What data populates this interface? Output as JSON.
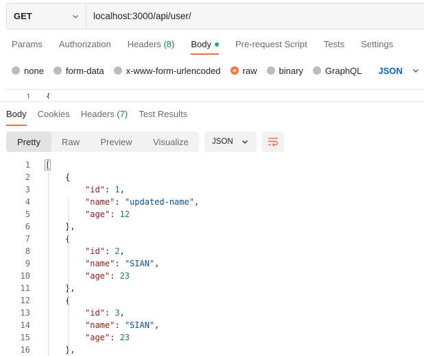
{
  "request": {
    "method": "GET",
    "url": "localhost:3000/api/user/"
  },
  "request_tabs": [
    {
      "label": "Params"
    },
    {
      "label": "Authorization"
    },
    {
      "label": "Headers",
      "count": "(8)"
    },
    {
      "label": "Body",
      "active": true,
      "dot": true
    },
    {
      "label": "Pre-request Script"
    },
    {
      "label": "Tests"
    },
    {
      "label": "Settings"
    }
  ],
  "body_types": [
    {
      "label": "none"
    },
    {
      "label": "form-data"
    },
    {
      "label": "x-www-form-urlencoded"
    },
    {
      "label": "raw",
      "checked": true
    },
    {
      "label": "binary"
    },
    {
      "label": "GraphQL"
    }
  ],
  "body_language": "JSON",
  "request_editor": {
    "line": "1",
    "text": "{"
  },
  "response_tabs": [
    {
      "label": "Body",
      "active": true
    },
    {
      "label": "Cookies"
    },
    {
      "label": "Headers",
      "count": "(7)"
    },
    {
      "label": "Test Results"
    }
  ],
  "view_modes": [
    {
      "label": "Pretty",
      "active": true
    },
    {
      "label": "Raw"
    },
    {
      "label": "Preview"
    },
    {
      "label": "Visualize"
    }
  ],
  "response_format": "JSON",
  "colors": {
    "accent": "#ff6c37",
    "link": "#0265d2",
    "count": "#0a8f3f"
  },
  "icons": {
    "wrap": "wrap-lines-icon",
    "dropdown": "chevron-down-icon"
  },
  "code_lines": [
    {
      "n": "1",
      "indent": 0,
      "parts": [
        {
          "t": "p",
          "v": "["
        }
      ]
    },
    {
      "n": "2",
      "indent": 1,
      "parts": [
        {
          "t": "p",
          "v": "{"
        }
      ]
    },
    {
      "n": "3",
      "indent": 2,
      "parts": [
        {
          "t": "k",
          "v": "\"id\""
        },
        {
          "t": "p",
          "v": ": "
        },
        {
          "t": "n",
          "v": "1"
        },
        {
          "t": "p",
          "v": ","
        }
      ]
    },
    {
      "n": "4",
      "indent": 2,
      "parts": [
        {
          "t": "k",
          "v": "\"name\""
        },
        {
          "t": "p",
          "v": ": "
        },
        {
          "t": "s",
          "v": "\"updated-name\""
        },
        {
          "t": "p",
          "v": ","
        }
      ]
    },
    {
      "n": "5",
      "indent": 2,
      "parts": [
        {
          "t": "k",
          "v": "\"age\""
        },
        {
          "t": "p",
          "v": ": "
        },
        {
          "t": "n",
          "v": "12"
        }
      ]
    },
    {
      "n": "6",
      "indent": 1,
      "parts": [
        {
          "t": "p",
          "v": "},"
        }
      ]
    },
    {
      "n": "7",
      "indent": 1,
      "parts": [
        {
          "t": "p",
          "v": "{"
        }
      ]
    },
    {
      "n": "8",
      "indent": 2,
      "parts": [
        {
          "t": "k",
          "v": "\"id\""
        },
        {
          "t": "p",
          "v": ": "
        },
        {
          "t": "n",
          "v": "2"
        },
        {
          "t": "p",
          "v": ","
        }
      ]
    },
    {
      "n": "9",
      "indent": 2,
      "parts": [
        {
          "t": "k",
          "v": "\"name\""
        },
        {
          "t": "p",
          "v": ": "
        },
        {
          "t": "s",
          "v": "\"SIAN\""
        },
        {
          "t": "p",
          "v": ","
        }
      ]
    },
    {
      "n": "10",
      "indent": 2,
      "parts": [
        {
          "t": "k",
          "v": "\"age\""
        },
        {
          "t": "p",
          "v": ": "
        },
        {
          "t": "n",
          "v": "23"
        }
      ]
    },
    {
      "n": "11",
      "indent": 1,
      "parts": [
        {
          "t": "p",
          "v": "},"
        }
      ]
    },
    {
      "n": "12",
      "indent": 1,
      "parts": [
        {
          "t": "p",
          "v": "{"
        }
      ]
    },
    {
      "n": "13",
      "indent": 2,
      "parts": [
        {
          "t": "k",
          "v": "\"id\""
        },
        {
          "t": "p",
          "v": ": "
        },
        {
          "t": "n",
          "v": "3"
        },
        {
          "t": "p",
          "v": ","
        }
      ]
    },
    {
      "n": "14",
      "indent": 2,
      "parts": [
        {
          "t": "k",
          "v": "\"name\""
        },
        {
          "t": "p",
          "v": ": "
        },
        {
          "t": "s",
          "v": "\"SIAN\""
        },
        {
          "t": "p",
          "v": ","
        }
      ]
    },
    {
      "n": "15",
      "indent": 2,
      "parts": [
        {
          "t": "k",
          "v": "\"age\""
        },
        {
          "t": "p",
          "v": ": "
        },
        {
          "t": "n",
          "v": "23"
        }
      ]
    },
    {
      "n": "16",
      "indent": 1,
      "parts": [
        {
          "t": "p",
          "v": "},"
        }
      ]
    }
  ]
}
